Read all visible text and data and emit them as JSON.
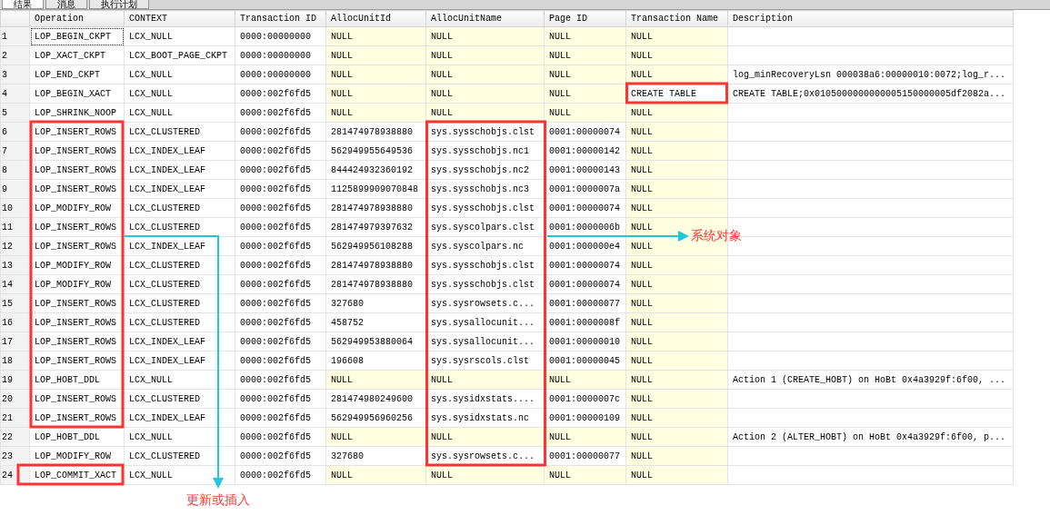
{
  "tabs": [
    {
      "label": "结果",
      "selected": true
    },
    {
      "label": "消息",
      "selected": false
    },
    {
      "label": "执行计划",
      "selected": false
    }
  ],
  "table": {
    "columns": [
      "Operation",
      "CONTEXT",
      "Transaction ID",
      "AllocUnitId",
      "AllocUnitName",
      "Page ID",
      "Transaction Name",
      "Description"
    ],
    "rows": [
      {
        "number": "1",
        "focused": true,
        "cells": [
          {
            "text": "LOP_BEGIN_CKPT",
            "null": false
          },
          {
            "text": "LCX_NULL",
            "null": false
          },
          {
            "text": "0000:00000000",
            "null": false
          },
          {
            "text": "NULL",
            "null": true
          },
          {
            "text": "NULL",
            "null": true
          },
          {
            "text": "NULL",
            "null": true
          },
          {
            "text": "NULL",
            "null": true
          }
        ]
      },
      {
        "number": "2",
        "focused": false,
        "cells": [
          {
            "text": "LOP_XACT_CKPT",
            "null": false
          },
          {
            "text": "LCX_BOOT_PAGE_CKPT",
            "null": false
          },
          {
            "text": "0000:00000000",
            "null": false
          },
          {
            "text": "NULL",
            "null": true
          },
          {
            "text": "NULL",
            "null": true
          },
          {
            "text": "NULL",
            "null": true
          },
          {
            "text": "NULL",
            "null": true
          }
        ]
      },
      {
        "number": "3",
        "focused": false,
        "cells": [
          {
            "text": "LOP_END_CKPT",
            "null": false
          },
          {
            "text": "LCX_NULL",
            "null": false
          },
          {
            "text": "0000:00000000",
            "null": false
          },
          {
            "text": "NULL",
            "null": true
          },
          {
            "text": "NULL",
            "null": true
          },
          {
            "text": "NULL",
            "null": true
          },
          {
            "text": "NULL",
            "null": true
          },
          {
            "text": "log_minRecoveryLsn 000038a6:00000010:0072;log_r...",
            "null": false
          }
        ]
      },
      {
        "number": "4",
        "focused": false,
        "cells": [
          {
            "text": "LOP_BEGIN_XACT",
            "null": false
          },
          {
            "text": "LCX_NULL",
            "null": false
          },
          {
            "text": "0000:002f6fd5",
            "null": false
          },
          {
            "text": "NULL",
            "null": true
          },
          {
            "text": "NULL",
            "null": true
          },
          {
            "text": "NULL",
            "null": true
          },
          {
            "text": "CREATE TABLE",
            "null": false
          },
          {
            "text": "CREATE TABLE;0x0105000000000005150000005df2082a...",
            "null": false
          }
        ]
      },
      {
        "number": "5",
        "focused": false,
        "cells": [
          {
            "text": "LOP_SHRINK_NOOP",
            "null": false
          },
          {
            "text": "LCX_NULL",
            "null": false
          },
          {
            "text": "0000:002f6fd5",
            "null": false
          },
          {
            "text": "NULL",
            "null": true
          },
          {
            "text": "NULL",
            "null": true
          },
          {
            "text": "NULL",
            "null": true
          },
          {
            "text": "NULL",
            "null": true
          }
        ]
      },
      {
        "number": "6",
        "focused": false,
        "cells": [
          {
            "text": "LOP_INSERT_ROWS",
            "null": false
          },
          {
            "text": "LCX_CLUSTERED",
            "null": false
          },
          {
            "text": "0000:002f6fd5",
            "null": false
          },
          {
            "text": "281474978938880",
            "null": false
          },
          {
            "text": "sys.sysschobjs.clst",
            "null": false
          },
          {
            "text": "0001:00000074",
            "null": false
          },
          {
            "text": "NULL",
            "null": true
          }
        ]
      },
      {
        "number": "7",
        "focused": false,
        "cells": [
          {
            "text": "LOP_INSERT_ROWS",
            "null": false
          },
          {
            "text": "LCX_INDEX_LEAF",
            "null": false
          },
          {
            "text": "0000:002f6fd5",
            "null": false
          },
          {
            "text": "562949955649536",
            "null": false
          },
          {
            "text": "sys.sysschobjs.nc1",
            "null": false
          },
          {
            "text": "0001:00000142",
            "null": false
          },
          {
            "text": "NULL",
            "null": true
          }
        ]
      },
      {
        "number": "8",
        "focused": false,
        "cells": [
          {
            "text": "LOP_INSERT_ROWS",
            "null": false
          },
          {
            "text": "LCX_INDEX_LEAF",
            "null": false
          },
          {
            "text": "0000:002f6fd5",
            "null": false
          },
          {
            "text": "844424932360192",
            "null": false
          },
          {
            "text": "sys.sysschobjs.nc2",
            "null": false
          },
          {
            "text": "0001:00000143",
            "null": false
          },
          {
            "text": "NULL",
            "null": true
          }
        ]
      },
      {
        "number": "9",
        "focused": false,
        "cells": [
          {
            "text": "LOP_INSERT_ROWS",
            "null": false
          },
          {
            "text": "LCX_INDEX_LEAF",
            "null": false
          },
          {
            "text": "0000:002f6fd5",
            "null": false
          },
          {
            "text": "1125899909070848",
            "null": false
          },
          {
            "text": "sys.sysschobjs.nc3",
            "null": false
          },
          {
            "text": "0001:0000007a",
            "null": false
          },
          {
            "text": "NULL",
            "null": true
          }
        ]
      },
      {
        "number": "10",
        "focused": false,
        "cells": [
          {
            "text": "LOP_MODIFY_ROW",
            "null": false
          },
          {
            "text": "LCX_CLUSTERED",
            "null": false
          },
          {
            "text": "0000:002f6fd5",
            "null": false
          },
          {
            "text": "281474978938880",
            "null": false
          },
          {
            "text": "sys.sysschobjs.clst",
            "null": false
          },
          {
            "text": "0001:00000074",
            "null": false
          },
          {
            "text": "NULL",
            "null": true
          }
        ]
      },
      {
        "number": "11",
        "focused": false,
        "cells": [
          {
            "text": "LOP_INSERT_ROWS",
            "null": false
          },
          {
            "text": "LCX_CLUSTERED",
            "null": false
          },
          {
            "text": "0000:002f6fd5",
            "null": false
          },
          {
            "text": "281474979397632",
            "null": false
          },
          {
            "text": "sys.syscolpars.clst",
            "null": false
          },
          {
            "text": "0001:0000006b",
            "null": false
          },
          {
            "text": "NULL",
            "null": true
          }
        ]
      },
      {
        "number": "12",
        "focused": false,
        "cells": [
          {
            "text": "LOP_INSERT_ROWS",
            "null": false
          },
          {
            "text": "LCX_INDEX_LEAF",
            "null": false
          },
          {
            "text": "0000:002f6fd5",
            "null": false
          },
          {
            "text": "562949956108288",
            "null": false
          },
          {
            "text": "sys.syscolpars.nc",
            "null": false
          },
          {
            "text": "0001:000000e4",
            "null": false
          },
          {
            "text": "NULL",
            "null": true
          }
        ]
      },
      {
        "number": "13",
        "focused": false,
        "cells": [
          {
            "text": "LOP_MODIFY_ROW",
            "null": false
          },
          {
            "text": "LCX_CLUSTERED",
            "null": false
          },
          {
            "text": "0000:002f6fd5",
            "null": false
          },
          {
            "text": "281474978938880",
            "null": false
          },
          {
            "text": "sys.sysschobjs.clst",
            "null": false
          },
          {
            "text": "0001:00000074",
            "null": false
          },
          {
            "text": "NULL",
            "null": true
          }
        ]
      },
      {
        "number": "14",
        "focused": false,
        "cells": [
          {
            "text": "LOP_MODIFY_ROW",
            "null": false
          },
          {
            "text": "LCX_CLUSTERED",
            "null": false
          },
          {
            "text": "0000:002f6fd5",
            "null": false
          },
          {
            "text": "281474978938880",
            "null": false
          },
          {
            "text": "sys.sysschobjs.clst",
            "null": false
          },
          {
            "text": "0001:00000074",
            "null": false
          },
          {
            "text": "NULL",
            "null": true
          }
        ]
      },
      {
        "number": "15",
        "focused": false,
        "cells": [
          {
            "text": "LOP_INSERT_ROWS",
            "null": false
          },
          {
            "text": "LCX_CLUSTERED",
            "null": false
          },
          {
            "text": "0000:002f6fd5",
            "null": false
          },
          {
            "text": "327680",
            "null": false
          },
          {
            "text": "sys.sysrowsets.c...",
            "null": false
          },
          {
            "text": "0001:00000077",
            "null": false
          },
          {
            "text": "NULL",
            "null": true
          }
        ]
      },
      {
        "number": "16",
        "focused": false,
        "cells": [
          {
            "text": "LOP_INSERT_ROWS",
            "null": false
          },
          {
            "text": "LCX_CLUSTERED",
            "null": false
          },
          {
            "text": "0000:002f6fd5",
            "null": false
          },
          {
            "text": "458752",
            "null": false
          },
          {
            "text": "sys.sysallocunit...",
            "null": false
          },
          {
            "text": "0001:0000008f",
            "null": false
          },
          {
            "text": "NULL",
            "null": true
          }
        ]
      },
      {
        "number": "17",
        "focused": false,
        "cells": [
          {
            "text": "LOP_INSERT_ROWS",
            "null": false
          },
          {
            "text": "LCX_INDEX_LEAF",
            "null": false
          },
          {
            "text": "0000:002f6fd5",
            "null": false
          },
          {
            "text": "562949953880064",
            "null": false
          },
          {
            "text": "sys.sysallocunit...",
            "null": false
          },
          {
            "text": "0001:00000010",
            "null": false
          },
          {
            "text": "NULL",
            "null": true
          }
        ]
      },
      {
        "number": "18",
        "focused": false,
        "cells": [
          {
            "text": "LOP_INSERT_ROWS",
            "null": false
          },
          {
            "text": "LCX_INDEX_LEAF",
            "null": false
          },
          {
            "text": "0000:002f6fd5",
            "null": false
          },
          {
            "text": "196608",
            "null": false
          },
          {
            "text": "sys.sysrscols.clst",
            "null": false
          },
          {
            "text": "0001:00000045",
            "null": false
          },
          {
            "text": "NULL",
            "null": true
          }
        ]
      },
      {
        "number": "19",
        "focused": false,
        "cells": [
          {
            "text": "LOP_HOBT_DDL",
            "null": false
          },
          {
            "text": "LCX_NULL",
            "null": false
          },
          {
            "text": "0000:002f6fd5",
            "null": false
          },
          {
            "text": "NULL",
            "null": true
          },
          {
            "text": "NULL",
            "null": true
          },
          {
            "text": "NULL",
            "null": true
          },
          {
            "text": "NULL",
            "null": true
          },
          {
            "text": "Action 1 (CREATE_HOBT) on HoBt 0x4a3929f:6f00, ...",
            "null": false
          }
        ]
      },
      {
        "number": "20",
        "focused": false,
        "cells": [
          {
            "text": "LOP_INSERT_ROWS",
            "null": false
          },
          {
            "text": "LCX_CLUSTERED",
            "null": false
          },
          {
            "text": "0000:002f6fd5",
            "null": false
          },
          {
            "text": "281474980249600",
            "null": false
          },
          {
            "text": "sys.sysidxstats....",
            "null": false
          },
          {
            "text": "0001:0000007c",
            "null": false
          },
          {
            "text": "NULL",
            "null": true
          }
        ]
      },
      {
        "number": "21",
        "focused": false,
        "cells": [
          {
            "text": "LOP_INSERT_ROWS",
            "null": false
          },
          {
            "text": "LCX_INDEX_LEAF",
            "null": false
          },
          {
            "text": "0000:002f6fd5",
            "null": false
          },
          {
            "text": "562949956960256",
            "null": false
          },
          {
            "text": "sys.sysidxstats.nc",
            "null": false
          },
          {
            "text": "0001:00000109",
            "null": false
          },
          {
            "text": "NULL",
            "null": true
          }
        ]
      },
      {
        "number": "22",
        "focused": false,
        "cells": [
          {
            "text": "LOP_HOBT_DDL",
            "null": false
          },
          {
            "text": "LCX_NULL",
            "null": false
          },
          {
            "text": "0000:002f6fd5",
            "null": false
          },
          {
            "text": "NULL",
            "null": true
          },
          {
            "text": "NULL",
            "null": true
          },
          {
            "text": "NULL",
            "null": true
          },
          {
            "text": "NULL",
            "null": true
          },
          {
            "text": "Action 2 (ALTER_HOBT) on HoBt 0x4a3929f:6f00, p...",
            "null": false
          }
        ]
      },
      {
        "number": "23",
        "focused": false,
        "cells": [
          {
            "text": "LOP_MODIFY_ROW",
            "null": false
          },
          {
            "text": "LCX_CLUSTERED",
            "null": false
          },
          {
            "text": "0000:002f6fd5",
            "null": false
          },
          {
            "text": "327680",
            "null": false
          },
          {
            "text": "sys.sysrowsets.c...",
            "null": false
          },
          {
            "text": "0001:00000077",
            "null": false
          },
          {
            "text": "NULL",
            "null": true
          }
        ]
      },
      {
        "number": "24",
        "focused": false,
        "cells": [
          {
            "text": "LOP_COMMIT_XACT",
            "null": false
          },
          {
            "text": "LCX_NULL",
            "null": false
          },
          {
            "text": "0000:002f6fd5",
            "null": false
          },
          {
            "text": "NULL",
            "null": true
          },
          {
            "text": "NULL",
            "null": true
          },
          {
            "text": "NULL",
            "null": true
          },
          {
            "text": "NULL",
            "null": true
          }
        ]
      }
    ]
  },
  "annotations": [
    "更新或插入",
    "系统对象"
  ]
}
